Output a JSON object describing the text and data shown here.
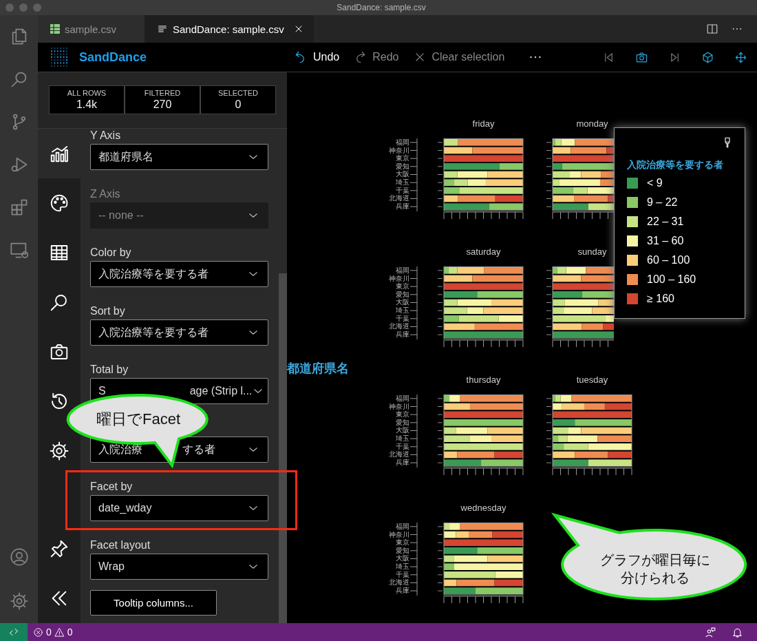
{
  "window": {
    "title": "SandDance: sample.csv"
  },
  "tabs": [
    {
      "label": "sample.csv",
      "selected": false,
      "kind": "csv"
    },
    {
      "label": "SandDance: sample.csv",
      "selected": true,
      "kind": "sanddance"
    }
  ],
  "toolbar": {
    "app_name": "SandDance",
    "actions": [
      {
        "label": "Undo",
        "disabled": false,
        "kind": "undo"
      },
      {
        "label": "Redo",
        "disabled": true,
        "kind": "redo"
      },
      {
        "label": "Clear selection",
        "disabled": true,
        "kind": "clear"
      }
    ],
    "view_buttons": [
      {
        "kind": "previous",
        "disabled": true
      },
      {
        "kind": "snapshot",
        "disabled": false
      },
      {
        "kind": "next",
        "disabled": true
      },
      {
        "kind": "camera3d",
        "disabled": false
      },
      {
        "kind": "move",
        "disabled": false
      }
    ]
  },
  "counters": [
    {
      "label": "ALL ROWS",
      "value": "1.4k"
    },
    {
      "label": "FILTERED",
      "value": "270"
    },
    {
      "label": "SELECTED",
      "value": "0"
    }
  ],
  "sidebar_tabs": [
    {
      "kind": "chart",
      "selected": true
    },
    {
      "kind": "color",
      "selected": false
    },
    {
      "kind": "data",
      "selected": false
    },
    {
      "kind": "search",
      "selected": false
    },
    {
      "kind": "snapshots",
      "selected": false
    },
    {
      "kind": "history",
      "selected": false
    },
    {
      "kind": "settings",
      "selected": false
    }
  ],
  "settings": [
    {
      "label": "Y Axis",
      "value": "都道府県名",
      "disabled": false
    },
    {
      "label": "Z Axis",
      "value": "-- none --",
      "disabled": true
    },
    {
      "label": "Color by",
      "value": "入院治療等を要する者",
      "disabled": false
    },
    {
      "label": "Sort by",
      "value": "入院治療等を要する者",
      "disabled": false
    },
    {
      "label": "Total by",
      "value": "S",
      "value_end": "age (Strip l...",
      "disabled": false
    },
    {
      "value": "入院治療",
      "value_end": "する者",
      "disabled": false
    },
    {
      "label": "Facet by",
      "value": "date_wday",
      "disabled": false
    },
    {
      "label": "Facet layout",
      "value": "Wrap",
      "disabled": false
    }
  ],
  "tooltip_button": "Tooltip columns...",
  "chart": {
    "y_axis_title": "都道府県名",
    "facets": [
      {
        "title": "friday",
        "labels": [
          "福岡",
          "神奈川",
          "東京",
          "愛知",
          "大阪",
          "埼玉",
          "千葉",
          "北海道",
          "兵庫"
        ]
      },
      {
        "title": "monday"
      },
      {
        "title": "saturday",
        "labels": [
          "福岡",
          "神奈川",
          "東京",
          "愛知",
          "大阪",
          "埼玉",
          "千葉",
          "北海道",
          "兵庫"
        ]
      },
      {
        "title": "sunday"
      },
      {
        "title": "thursday",
        "labels": [
          "福岡",
          "神奈川",
          "東京",
          "愛知",
          "大阪",
          "埼玉",
          "千葉",
          "北海道",
          "兵庫"
        ]
      },
      {
        "title": "tuesday"
      },
      {
        "title": "wednesday",
        "labels": [
          "福岡",
          "神奈川",
          "東京",
          "愛知",
          "大阪",
          "埼玉",
          "千葉",
          "北海道",
          "兵庫"
        ]
      }
    ]
  },
  "legend": {
    "title": "入院治療等を要する者",
    "items": [
      {
        "label": "< 9",
        "color": "#3a9b55"
      },
      {
        "label": "9 – 22",
        "color": "#88c866"
      },
      {
        "label": "22 – 31",
        "color": "#c7e383"
      },
      {
        "label": "31 – 60",
        "color": "#f7f4a6"
      },
      {
        "label": "60 – 100",
        "color": "#fbcd7b"
      },
      {
        "label": "100 – 160",
        "color": "#ef8c52"
      },
      {
        "label": "≥ 160",
        "color": "#d44532"
      }
    ]
  },
  "annotations": [
    {
      "text": "曜日でFacet"
    },
    {
      "text": "グラフが曜日毎に分けられる"
    }
  ],
  "status_bar": {
    "errors": "0",
    "warnings": "0"
  }
}
